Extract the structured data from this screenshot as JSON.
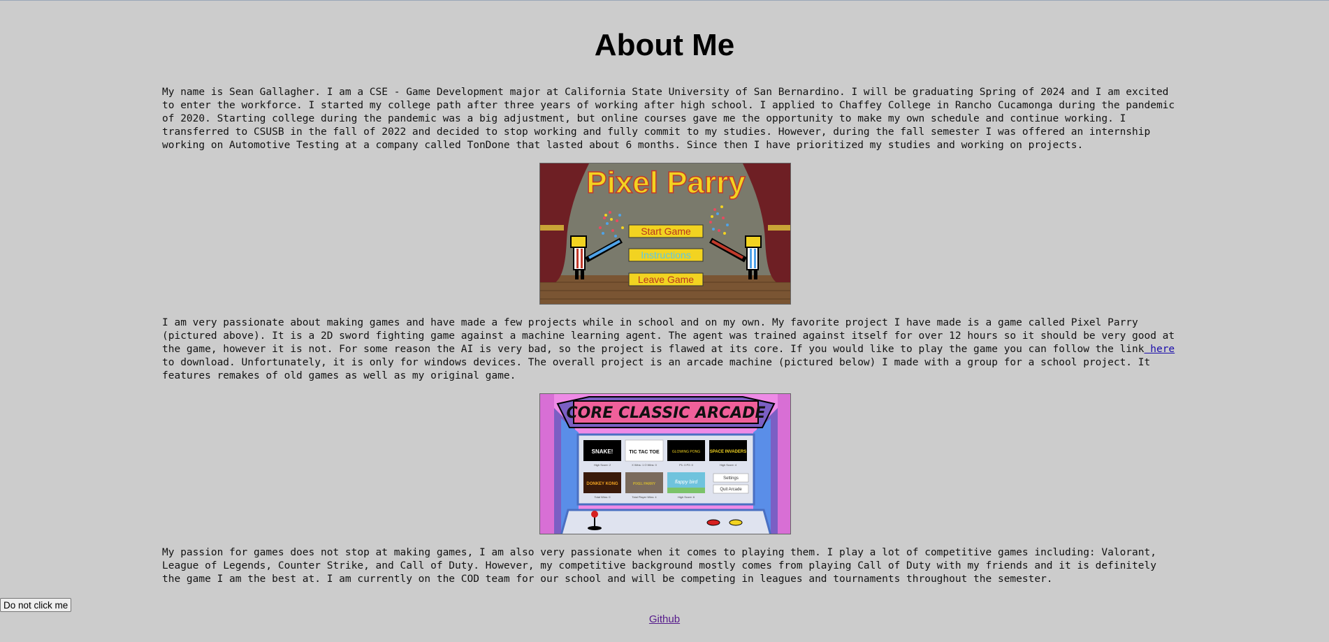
{
  "page": {
    "title": "About Me"
  },
  "paragraphs": {
    "intro": "My name is Sean Gallagher. I am a CSE - Game Development major at California State University of San Bernardino. I will be graduating Spring of 2024 and I am excited to enter the workforce. I started my college path after three years of working after high school. I applied to Chaffey College in Rancho Cucamonga during the pandemic of 2020. Starting college during the pandemic was a big adjustment, but online courses gave me the opportunity to make my own schedule and continue working. I transferred to CSUSB in the fall of 2022 and decided to stop working and fully commit to my studies. However, during the fall semester I was offered an internship working on Automotive Testing at a company called TonDone that lasted about 6 months. Since then I have prioritized my studies and working on projects.",
    "projects_before_link": "I am very passionate about making games and have made a few projects while in school and on my own. My favorite project I have made is a game called Pixel Parry (pictured above). It is a 2D sword fighting game against a machine learning agent. The agent was trained against itself for over 12 hours so it should be very good at the game, however it is not. For some reason the AI is very bad, so the project is flawed at its core. If you would like to play the game you can follow the link",
    "projects_link": " here ",
    "projects_after_link": "to download. Unfortunately, it is only for windows devices. The overall project is an arcade machine (pictured below) I made with a group for a school project. It features remakes of old games as well as my original game.",
    "gaming": "My passion for games does not stop at making games, I am also very passionate when it comes to playing them. I play a lot of competitive games including: Valorant, League of Legends, Counter Strike, and Call of Duty. However, my competitive background mostly comes from playing Call of Duty with my friends and it is definitely the game I am the best at. I am currently on the COD team for our school and will be competing in leagues and tournaments throughout the semester."
  },
  "pixel_parry_image": {
    "logo": "Pixel Parry",
    "menu": [
      "Start Game",
      "Instructions",
      "Leave Game"
    ],
    "colors": {
      "curtain": "#6e1f24",
      "background": "#7a7a6c",
      "floor": "#7a5533",
      "button": "#f2d321",
      "button_text": "#b8361f",
      "button_text_alt": "#5ac8e8"
    }
  },
  "arcade_image": {
    "banner": "CORE CLASSIC ARCADE",
    "games": [
      {
        "label": "SNAKE!",
        "caption": "High Score: 2"
      },
      {
        "label": "TIC TAC TOE",
        "caption": "X Wins: 1   O Wins: 0"
      },
      {
        "label": "GLOWING PONG",
        "caption": "P1: 0   P2: 0"
      },
      {
        "label": "SPACE INVADERS",
        "caption": "High Score: 4"
      },
      {
        "label": "DONKEY KONG",
        "caption": "Total Wins: 0"
      },
      {
        "label": "PIXEL PARRY",
        "caption": "Total Player Wins: 4"
      },
      {
        "label": "flappy bird",
        "caption": "High Score: 6"
      }
    ],
    "side_buttons": [
      "Settings",
      "Quit Arcade"
    ],
    "colors": {
      "background": "#ee8ae6",
      "banner": "#f0609a",
      "cabinet_purple": "#7b5fc4",
      "cabinet_blue": "#5a8ee8",
      "screen": "#dfe3ef"
    }
  },
  "buttons": {
    "dont_click": "Do not click me"
  },
  "footer": {
    "github_label": "Github"
  }
}
